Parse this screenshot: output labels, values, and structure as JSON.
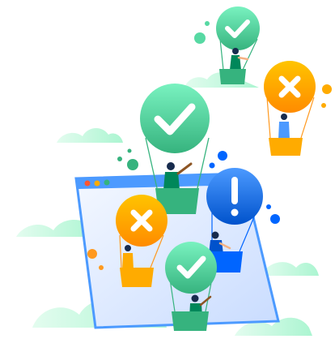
{
  "illustration": {
    "colors": {
      "green": "#36b37e",
      "green_light": "#57d9a3",
      "orange": "#ff991f",
      "orange_light": "#ffab00",
      "blue": "#0065ff",
      "blue_light": "#4c9aff",
      "cloud": "#abf5d1",
      "cloud_light": "#e3fcef",
      "window_frame": "#4c9aff",
      "window_bg": "#deebff"
    },
    "window_dots": [
      "#ff5630",
      "#ffab00",
      "#36b37e"
    ],
    "balloons": [
      {
        "id": "top-green",
        "icon": "check-icon",
        "status": "approved"
      },
      {
        "id": "right-orange",
        "icon": "x-icon",
        "status": "rejected"
      },
      {
        "id": "center-green",
        "icon": "check-icon",
        "status": "approved"
      },
      {
        "id": "blue-info",
        "icon": "exclamation-icon",
        "status": "warning"
      },
      {
        "id": "left-orange",
        "icon": "x-icon",
        "status": "rejected"
      },
      {
        "id": "bottom-green",
        "icon": "check-icon",
        "status": "approved"
      }
    ]
  }
}
